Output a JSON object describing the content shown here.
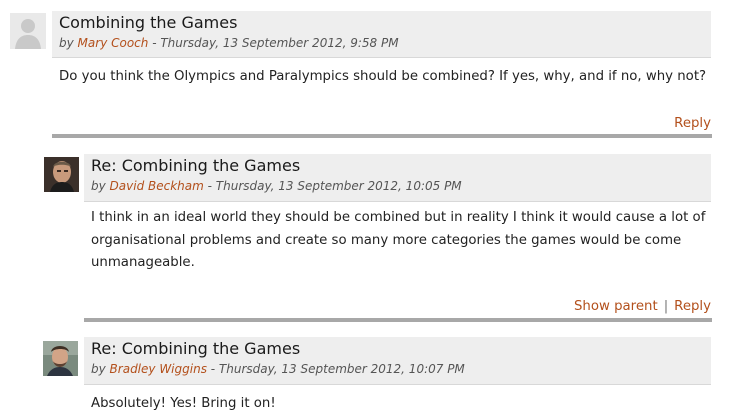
{
  "colors": {
    "link": "#b3501c",
    "header_bg": "#eeeeee",
    "separator": "#a8a8a8"
  },
  "posts": [
    {
      "avatar": "default-user-icon",
      "subject": "Combining the Games",
      "by": "by",
      "author": "Mary Cooch",
      "date": " - Thursday, 13 September 2012, 9:58 PM",
      "message": "Do you think the Olympics and Paralympics should be combined? If yes, why, and if no, why not?",
      "commands": {
        "reply": "Reply"
      }
    },
    {
      "avatar": "user-photo",
      "subject": "Re: Combining the Games",
      "by": "by",
      "author": "David Beckham",
      "date": " - Thursday, 13 September 2012, 10:05 PM",
      "message": "I think in an ideal world they should be combined but in reality I think it would cause a lot of organisational problems and create so many more categories the games would be come unmanageable.",
      "commands": {
        "show_parent": "Show parent",
        "separator": "|",
        "reply": "Reply"
      }
    },
    {
      "avatar": "user-photo",
      "subject": "Re: Combining the Games",
      "by": "by",
      "author": "Bradley Wiggins",
      "date": " - Thursday, 13 September 2012, 10:07 PM",
      "message": "Absolutely! Yes! Bring it on!"
    }
  ]
}
